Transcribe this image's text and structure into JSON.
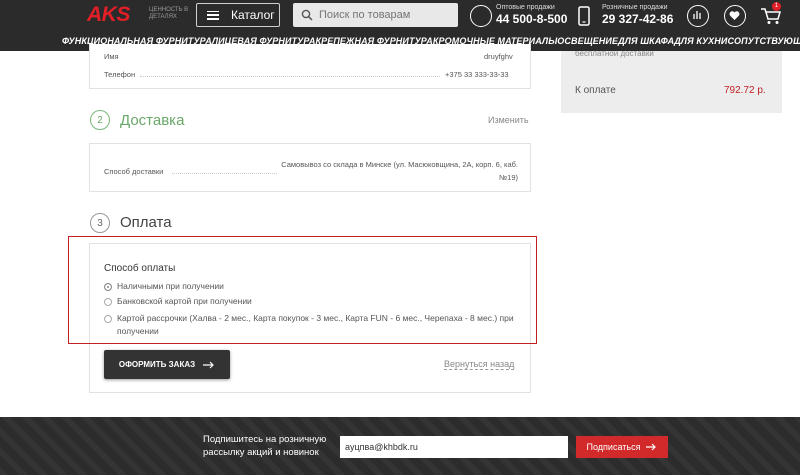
{
  "header": {
    "logo": "AKS",
    "tagline": "ЦЕННОСТЬ В ДЕТАЛЯХ",
    "catalog_label": "Каталог",
    "search_placeholder": "Поиск по товарам",
    "wholesale_label": "Оптовые продажи",
    "wholesale_phone": "44 500-8-500",
    "retail_label": "Розничные продажи",
    "retail_phone": "29 327-42-86",
    "cart_count": "1"
  },
  "nav": [
    "ФУНКЦИОНАЛЬНАЯ ФУРНИТУРА",
    "ЛИЦЕВАЯ ФУРНИТУРА",
    "КРЕПЕЖНАЯ ФУРНИТУРА",
    "КРОМОЧНЫЕ МАТЕРИАЛЫ",
    "ОСВЕЩЕНИЕ",
    "ДЛЯ ШКАФА",
    "ДЛЯ КУХНИ",
    "СОПУТСТВУЮЩИЕ"
  ],
  "contact": {
    "name_label": "Имя",
    "name_value": "druyfghv",
    "phone_label": "Телефон",
    "phone_value": "+375 33 333-33-33"
  },
  "delivery": {
    "step": "2",
    "title": "Доставка",
    "change_link": "Изменить",
    "method_label": "Способ доставки",
    "method_value": "Самовывоз со склада в Минске (ул. Масюковщина, 2А, корп. 6, каб. №19)"
  },
  "payment": {
    "step": "3",
    "title": "Оплата",
    "method_label": "Способ оплаты",
    "options": [
      "Наличными при получении",
      "Банковской картой при получении",
      "Картой рассрочки (Халва - 2 мес., Карта покупок - 3 мес., Карта FUN - 6 мес., Черепаха - 8 мес.) при получении"
    ],
    "selected_index": 0
  },
  "actions": {
    "order_button": "ОФОРМИТЬ ЗАКАЗ",
    "back_link": "Вернуться назад"
  },
  "summary": {
    "top_note": "бесплатной доставки",
    "total_label": "К оплате",
    "total_value": "792.72 р."
  },
  "footer": {
    "subscribe_text": "Подпишитесь на розничную рассылку акций и новинок",
    "email_value": "ayцпва@khbdk.ru",
    "subscribe_button": "Подписаться"
  }
}
